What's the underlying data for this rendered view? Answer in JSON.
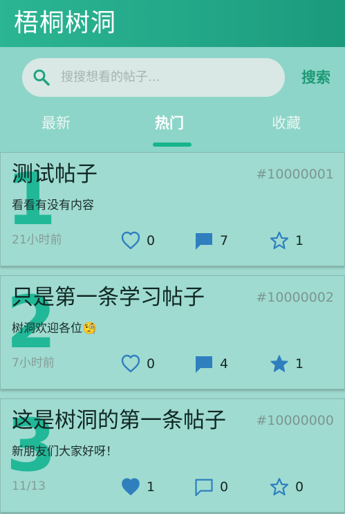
{
  "app": {
    "title": "梧桐树洞"
  },
  "search": {
    "placeholder": "搜搜想看的帖子...",
    "button_label": "搜索"
  },
  "tabs": [
    {
      "label": "最新",
      "active": false
    },
    {
      "label": "热门",
      "active": true
    },
    {
      "label": "收藏",
      "active": false
    }
  ],
  "posts": [
    {
      "rank": "1",
      "title": "测试帖子",
      "id": "#10000001",
      "content": "看看有没有内容",
      "time": "21小时前",
      "likes": "0",
      "comments": "7",
      "stars": "1",
      "liked": false,
      "commented": true,
      "starred": false
    },
    {
      "rank": "2",
      "title": "只是第一条学习帖子",
      "id": "#10000002",
      "content": "树洞欢迎各位🧐",
      "time": "7小时前",
      "likes": "0",
      "comments": "4",
      "stars": "1",
      "liked": false,
      "commented": true,
      "starred": true
    },
    {
      "rank": "3",
      "title": "这是树洞的第一条帖子",
      "id": "#10000000",
      "content": "新朋友们大家好呀！",
      "time": "11/13",
      "likes": "1",
      "comments": "0",
      "stars": "0",
      "liked": true,
      "commented": false,
      "starred": false
    }
  ],
  "colors": {
    "header_start": "#2bb592",
    "header_end": "#1b9a7c",
    "accent": "#16b58b",
    "icon_blue": "#2f7fbf",
    "card_bg": "#9fdbd1"
  },
  "icons": {
    "search": "search-icon",
    "like": "heart-icon",
    "comment": "comment-icon",
    "star": "star-icon"
  }
}
